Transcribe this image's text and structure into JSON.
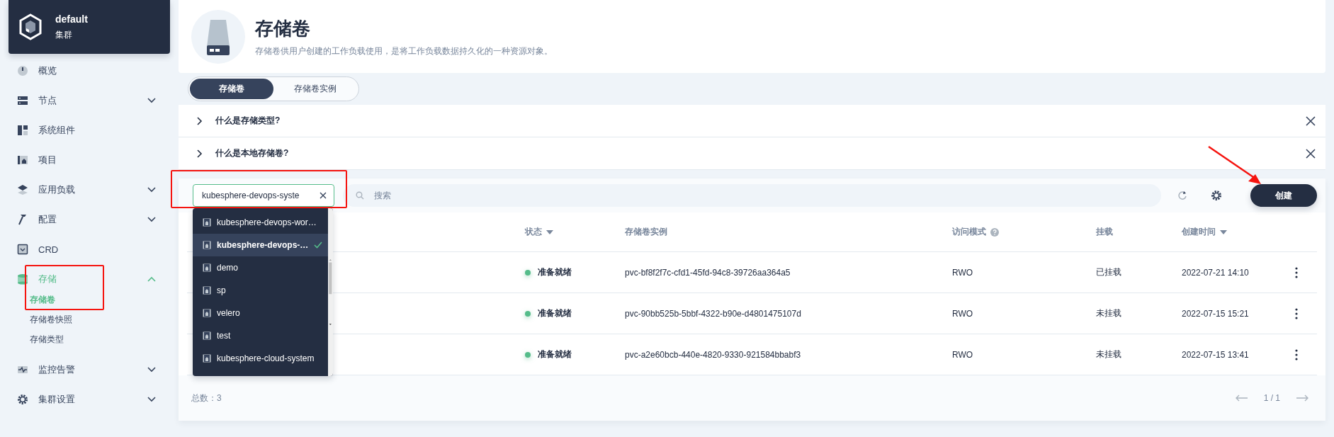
{
  "cluster": {
    "name": "default",
    "type": "集群"
  },
  "sidebar": {
    "items": [
      {
        "label": "概览",
        "kind": "gauge",
        "has_submenu": false,
        "expanded": false,
        "selected": false
      },
      {
        "label": "节点",
        "kind": "server",
        "has_submenu": true,
        "expanded": false,
        "selected": false
      },
      {
        "label": "系统组件",
        "kind": "tiles",
        "has_submenu": false,
        "expanded": false,
        "selected": false
      },
      {
        "label": "项目",
        "kind": "project",
        "has_submenu": false,
        "expanded": false,
        "selected": false
      },
      {
        "label": "应用负载",
        "kind": "layers",
        "has_submenu": true,
        "expanded": false,
        "selected": false
      },
      {
        "label": "配置",
        "kind": "hammer",
        "has_submenu": true,
        "expanded": false,
        "selected": false
      },
      {
        "label": "CRD",
        "kind": "crd",
        "has_submenu": false,
        "expanded": false,
        "selected": false
      },
      {
        "label": "存储",
        "kind": "database",
        "has_submenu": true,
        "expanded": true,
        "selected": true,
        "children": [
          {
            "label": "存储卷",
            "selected": true
          },
          {
            "label": "存储卷快照",
            "selected": false
          },
          {
            "label": "存储类型",
            "selected": false
          }
        ]
      },
      {
        "label": "监控告警",
        "kind": "monitor",
        "has_submenu": true,
        "expanded": false,
        "selected": false
      },
      {
        "label": "集群设置",
        "kind": "gear",
        "has_submenu": true,
        "expanded": false,
        "selected": false
      }
    ]
  },
  "header": {
    "title": "存储卷",
    "description": "存储卷供用户创建的工作负载使用，是将工作负载数据持久化的一种资源对象。"
  },
  "tabs": [
    {
      "label": "存储卷",
      "selected": true
    },
    {
      "label": "存储卷实例",
      "selected": false
    }
  ],
  "banners": [
    {
      "title": "什么是存储类型?"
    },
    {
      "title": "什么是本地存储卷?"
    }
  ],
  "toolbar": {
    "namespace_filter": "kubesphere-devops-syste",
    "search": {
      "placeholder": "搜索"
    },
    "create_button": "创建"
  },
  "namespace_dropdown": [
    {
      "label": "kubesphere-devops-wor…",
      "selected": false
    },
    {
      "label": "kubesphere-devops-…",
      "selected": true
    },
    {
      "label": "demo",
      "selected": false
    },
    {
      "label": "sp",
      "selected": false
    },
    {
      "label": "velero",
      "selected": false
    },
    {
      "label": "test",
      "selected": false
    },
    {
      "label": "kubesphere-cloud-system",
      "selected": false
    }
  ],
  "table": {
    "columns": [
      {
        "label": "状态",
        "sortable": true,
        "help": false
      },
      {
        "label": "存储卷实例",
        "sortable": false,
        "help": false
      },
      {
        "label": "访问模式",
        "sortable": false,
        "help": true
      },
      {
        "label": "挂载",
        "sortable": false,
        "help": false
      },
      {
        "label": "创建时间",
        "sortable": true,
        "help": false
      }
    ],
    "rows": [
      {
        "status": "准备就绪",
        "volume": "pvc-bf8f2f7c-cfd1-45fd-94c8-39726aa364a5",
        "access_mode": "RWO",
        "mount": "已挂载",
        "created": "2022-07-21 14:10"
      },
      {
        "status": "准备就绪",
        "volume": "pvc-90bb525b-5bbf-4322-b90e-d4801475107d",
        "access_mode": "RWO",
        "mount": "未挂载",
        "created": "2022-07-15 15:21"
      },
      {
        "status": "准备就绪",
        "volume": "pvc-a2e60bcb-440e-4820-9330-921584bbabf3",
        "access_mode": "RWO",
        "mount": "未挂载",
        "created": "2022-07-15 13:41"
      }
    ]
  },
  "footer": {
    "total": "总数：3",
    "page": "1 / 1"
  }
}
